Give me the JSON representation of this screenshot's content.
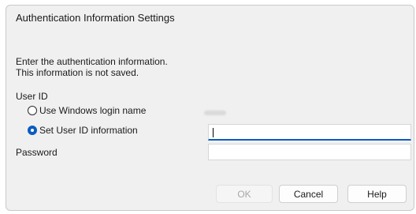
{
  "dialog": {
    "title": "Authentication Information Settings",
    "desc_line1": "Enter the authentication information.",
    "desc_line2": "This information is not saved.",
    "user_id_label": "User ID",
    "option_windows": "Use Windows login name",
    "option_set": "Set User ID information",
    "selected_option": "Set User ID information",
    "password_label": "Password",
    "user_id_value": "",
    "password_value": ""
  },
  "buttons": {
    "ok": "OK",
    "cancel": "Cancel",
    "help": "Help"
  },
  "colors": {
    "accent": "#0b5cc2",
    "dialog_bg": "#f0f0f0"
  }
}
